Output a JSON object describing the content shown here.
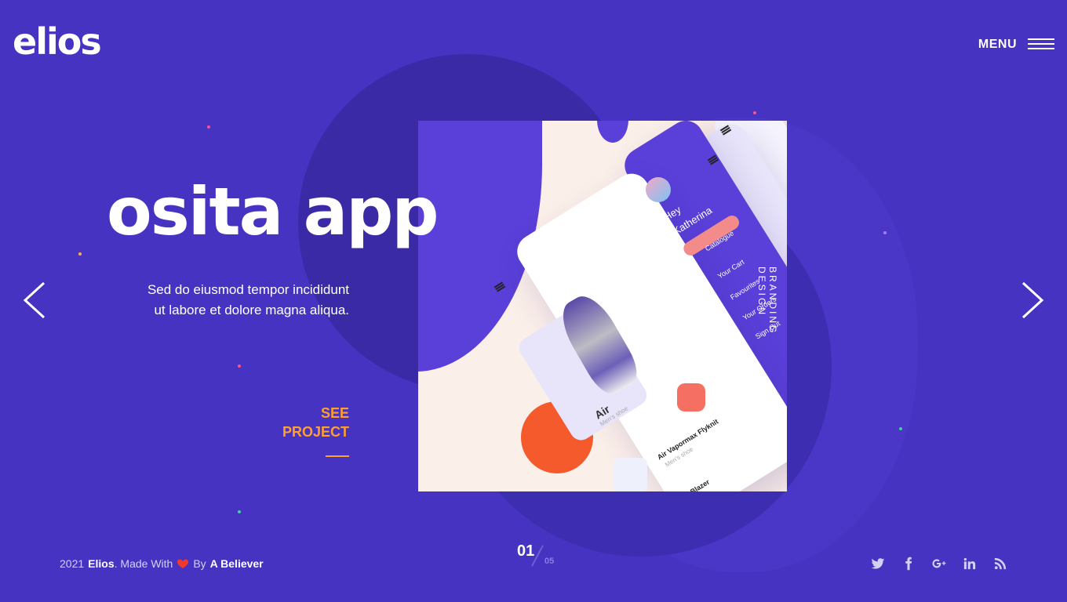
{
  "logo": {
    "text": "elios"
  },
  "menu": {
    "label": "MENU"
  },
  "slide": {
    "title": "osita app",
    "description": "Sed do eiusmod tempor incididunt ut labore et dolore magna aliqua.",
    "cta_line1": "SEE",
    "cta_line2": "PROJECT",
    "category": "BRANDING DESIGN"
  },
  "mockup": {
    "greeting": "Hey",
    "user_name": "Katherina",
    "menu_items": [
      "Catalogue",
      "Your Cart",
      "Favourites",
      "Your Orders",
      "Sign Out"
    ],
    "product_name": "Air",
    "product_sub": "Men's shoe",
    "product2_name": "Air Vapormax Flyknit",
    "product2_sub": "Men's shoe",
    "product3_name": "Blazer"
  },
  "pager": {
    "current": "01",
    "total": "05"
  },
  "footer": {
    "year": "2021",
    "brand": "Elios",
    "made_with": ". Made With",
    "by": "By",
    "author": "A Believer"
  },
  "social_icons": [
    "twitter-icon",
    "facebook-icon",
    "google-plus-icon",
    "linkedin-icon",
    "rss-icon"
  ],
  "colors": {
    "background": "#4733c2",
    "accent": "#ff9f2e",
    "heart": "#f03a2e"
  }
}
